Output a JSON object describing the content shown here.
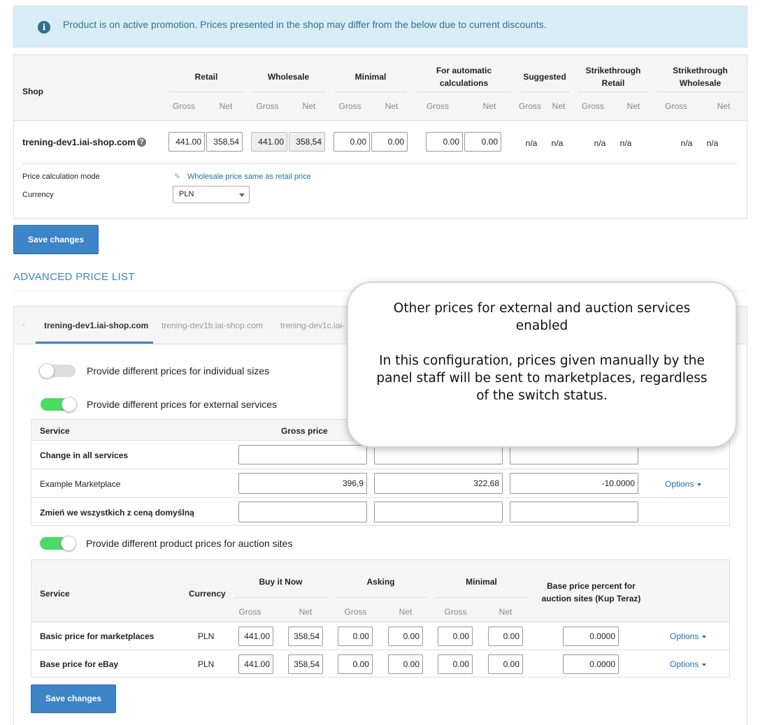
{
  "promo": {
    "text": "Product is on active promotion. Prices presented in the shop may differ from the below due to current discounts."
  },
  "price_table": {
    "shop_header": "Shop",
    "groups": [
      {
        "label": "Retail",
        "sub": [
          "Gross",
          "Net"
        ]
      },
      {
        "label": "Wholesale",
        "sub": [
          "Gross",
          "Net"
        ]
      },
      {
        "label": "Minimal",
        "sub": [
          "Gross",
          "Net"
        ]
      },
      {
        "label": "For automatic calculations",
        "sub": [
          "Gross",
          "Net"
        ]
      },
      {
        "label": "Suggested",
        "sub": [
          "Gross",
          "Net"
        ]
      },
      {
        "label": "Strikethrough Retail",
        "sub": [
          "Gross",
          "Net"
        ]
      },
      {
        "label": "Strikethrough Wholesale",
        "sub": [
          "Gross",
          "Net"
        ]
      }
    ],
    "shop_name": "trening-dev1.iai-shop.com",
    "values": {
      "retail_gross": "441.00",
      "retail_net": "358,54",
      "wholesale_gross": "441.00",
      "wholesale_net": "358,54",
      "minimal_gross": "0.00",
      "minimal_net": "0.00",
      "auto_gross": "0.00",
      "auto_net": "0.00",
      "na": "n/a"
    },
    "calc_mode_label": "Price calculation mode",
    "calc_mode_value": "Wholesale price same as retail price",
    "currency_label": "Currency",
    "currency_value": "PLN",
    "save_label": "Save changes"
  },
  "advanced": {
    "title": "ADVANCED PRICE LIST",
    "tabs": [
      "trening-dev1.iai-shop.com",
      "trening-dev1b.iai-shop.com",
      "trening-dev1c.iai-"
    ],
    "toggle_sizes": "Provide different prices for individual sizes",
    "toggle_external": "Provide different prices for external services",
    "toggle_auction": "Provide different product prices for auction sites",
    "external": {
      "col_service": "Service",
      "col_gross": "Gross price",
      "rows": [
        {
          "name": "Change in all services",
          "v1": "",
          "v2": "",
          "v3": ""
        },
        {
          "name": "Example Marketplace",
          "v1": "396,9",
          "v2": "322,68",
          "v3": "-10.0000",
          "options": "Options"
        },
        {
          "name": "Zmień we wszystkich z ceną domyślną",
          "v1": "",
          "v2": "",
          "v3": ""
        }
      ]
    },
    "auction": {
      "col_service": "Service",
      "col_currency": "Currency",
      "col_buy": "Buy it Now",
      "col_asking": "Asking",
      "col_minimal": "Minimal",
      "col_base": "Base price percent for auction sites (Kup Teraz)",
      "sub": [
        "Gross",
        "Net"
      ],
      "rows": [
        {
          "name": "Basic price for marketplaces",
          "currency": "PLN",
          "buy_g": "441.00",
          "buy_n": "358,54",
          "ask_g": "0.00",
          "ask_n": "0.00",
          "min_g": "0.00",
          "min_n": "0.00",
          "base": "0.0000",
          "options": "Options"
        },
        {
          "name": "Base price for eBay",
          "currency": "PLN",
          "buy_g": "441.00",
          "buy_n": "358,54",
          "ask_g": "0.00",
          "ask_n": "0.00",
          "min_g": "0.00",
          "min_n": "0.00",
          "base": "0.0000",
          "options": "Options"
        }
      ]
    },
    "save_label": "Save changes"
  },
  "tooltip": {
    "title": "Other prices for external and auction services enabled",
    "body": "In this configuration, prices given manually by the panel staff will be sent to marketplaces, regardless of the switch status."
  },
  "colors": {
    "accent": "#3d85c6",
    "toggle_on": "#4cd964",
    "promo_bg": "#d9edf7"
  }
}
